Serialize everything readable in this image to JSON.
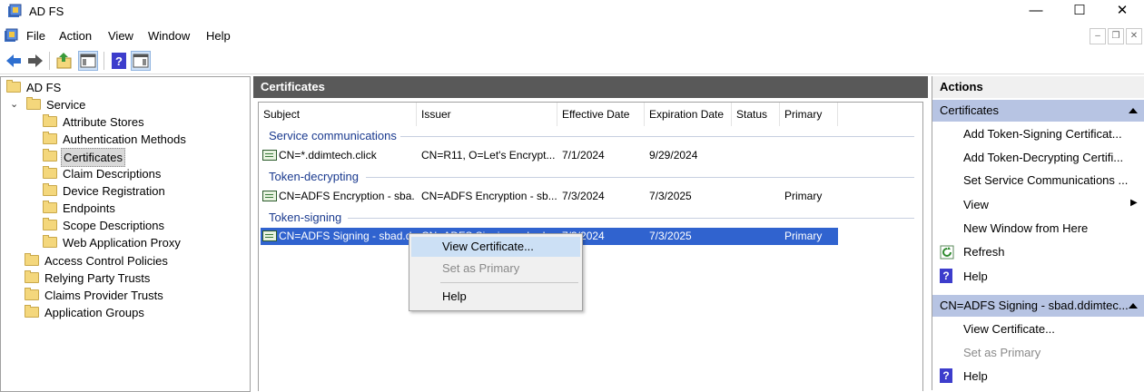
{
  "window": {
    "title": "AD FS"
  },
  "menu": [
    "File",
    "Action",
    "View",
    "Window",
    "Help"
  ],
  "tree": {
    "root": "AD FS",
    "service": "Service",
    "children": [
      "Attribute Stores",
      "Authentication Methods",
      "Certificates",
      "Claim Descriptions",
      "Device Registration",
      "Endpoints",
      "Scope Descriptions",
      "Web Application Proxy"
    ],
    "top_level": [
      "Access Control Policies",
      "Relying Party Trusts",
      "Claims Provider Trusts",
      "Application Groups"
    ],
    "selected": "Certificates"
  },
  "center": {
    "title": "Certificates",
    "columns": [
      "Subject",
      "Issuer",
      "Effective Date",
      "Expiration Date",
      "Status",
      "Primary"
    ],
    "groups": [
      {
        "title": "Service communications",
        "rows": [
          {
            "subject": "CN=*.ddimtech.click",
            "issuer": "CN=R11, O=Let's Encrypt...",
            "effective": "7/1/2024",
            "expiration": "9/29/2024",
            "status": "",
            "primary": ""
          }
        ]
      },
      {
        "title": "Token-decrypting",
        "rows": [
          {
            "subject": "CN=ADFS Encryption - sba...",
            "issuer": "CN=ADFS Encryption - sb...",
            "effective": "7/3/2024",
            "expiration": "7/3/2025",
            "status": "",
            "primary": "Primary"
          }
        ]
      },
      {
        "title": "Token-signing",
        "rows": [
          {
            "subject": "CN=ADFS Signing - sbad.d...",
            "issuer": "CN=ADFS Signing - sbad...",
            "effective": "7/3/2024",
            "expiration": "7/3/2025",
            "status": "",
            "primary": "Primary"
          }
        ]
      }
    ]
  },
  "context_menu": {
    "items": [
      "View Certificate...",
      "Set as Primary",
      "Help"
    ]
  },
  "actions": {
    "title": "Actions",
    "section1": {
      "title": "Certificates",
      "items": [
        "Add Token-Signing Certificat...",
        "Add Token-Decrypting Certifi...",
        "Set Service Communications ...",
        "View",
        "New Window from Here",
        "Refresh",
        "Help"
      ]
    },
    "section2": {
      "title": "CN=ADFS Signing - sbad.ddimtec...",
      "items": [
        "View Certificate...",
        "Set as Primary",
        "Help"
      ]
    }
  },
  "colors": {
    "selection": "#3063cf",
    "center_header": "#595959",
    "action_section": "#b7c4e3",
    "context_highlight": "#cce0f5",
    "group_title": "#1a3a8f"
  }
}
